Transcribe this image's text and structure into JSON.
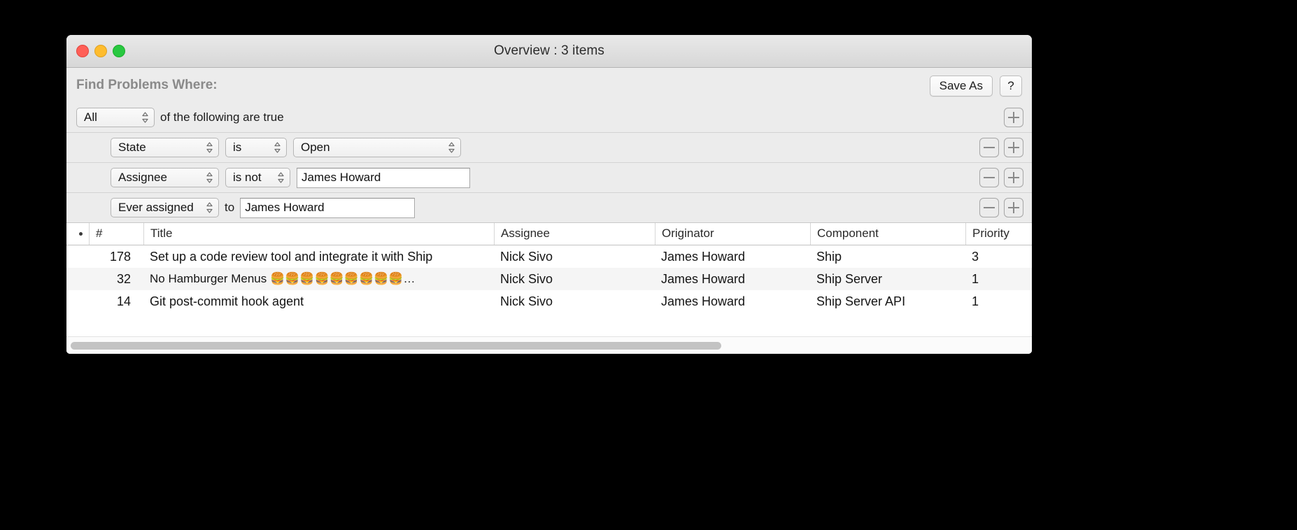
{
  "window": {
    "title": "Overview : 3 items",
    "traffic_lights": {
      "close": "close-button",
      "minimize": "minimize-button",
      "maximize": "maximize-button"
    },
    "colors": {
      "close": "#ff5f57",
      "minimize": "#febc2e",
      "maximize": "#28c840",
      "window_bg": "#ececec",
      "table_bg": "#ffffff",
      "alt_row": "#f5f5f5",
      "label_gray": "#8a8a8a"
    }
  },
  "filter": {
    "heading": "Find Problems Where:",
    "save_as_label": "Save As",
    "help_label": "?",
    "match_mode": "All",
    "match_suffix": "of the following are true",
    "add_icon": "plus-icon",
    "remove_icon": "minus-icon",
    "rows": [
      {
        "field": "State",
        "operator": "is",
        "value": "Open",
        "value_kind": "popup"
      },
      {
        "field": "Assignee",
        "operator": "is not",
        "value": "James Howard",
        "value_kind": "text"
      },
      {
        "field": "Ever assigned",
        "operator": "to",
        "value": "James Howard",
        "value_kind": "text",
        "operator_kind": "label"
      }
    ]
  },
  "table": {
    "columns": [
      {
        "key": "dot",
        "label": "•"
      },
      {
        "key": "number",
        "label": "#"
      },
      {
        "key": "title",
        "label": "Title"
      },
      {
        "key": "assignee",
        "label": "Assignee"
      },
      {
        "key": "originator",
        "label": "Originator"
      },
      {
        "key": "component",
        "label": "Component"
      },
      {
        "key": "priority",
        "label": "Priority"
      }
    ],
    "rows": [
      {
        "number": "178",
        "title": "Set up a code review tool and integrate it with Ship",
        "assignee": "Nick Sivo",
        "originator": "James Howard",
        "component": "Ship",
        "priority": "3"
      },
      {
        "number": "32",
        "title": "No Hamburger Menus 🍔🍔🍔🍔🍔🍔🍔🍔🍔…",
        "assignee": "Nick Sivo",
        "originator": "James Howard",
        "component": "Ship Server",
        "priority": "1"
      },
      {
        "number": "14",
        "title": "Git post-commit hook agent",
        "assignee": "Nick Sivo",
        "originator": "James Howard",
        "component": "Ship Server API",
        "priority": "1"
      }
    ]
  },
  "scrollbar": {
    "orientation": "horizontal",
    "thumb_fraction_percent": 68
  }
}
